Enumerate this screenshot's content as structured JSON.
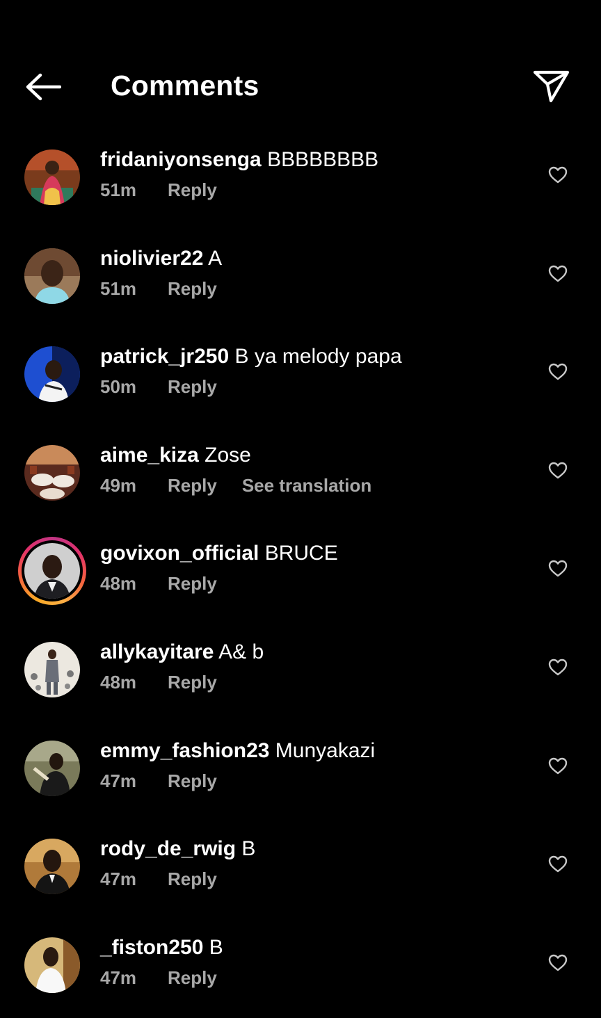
{
  "header": {
    "title": "Comments",
    "back_icon": "arrow-left-icon",
    "share_icon": "paper-plane-icon"
  },
  "colors": {
    "background": "#000000",
    "text_primary": "#ffffff",
    "text_secondary": "#a8a8a8"
  },
  "comments": [
    {
      "username": "fridaniyonsenga",
      "text": "BBBBBBBB",
      "time": "51m",
      "reply": "Reply",
      "has_story": false
    },
    {
      "username": "niolivier22",
      "text": "A",
      "time": "51m",
      "reply": "Reply",
      "has_story": false
    },
    {
      "username": "patrick_jr250",
      "text": "B ya melody papa",
      "time": "50m",
      "reply": "Reply",
      "has_story": false
    },
    {
      "username": "aime_kiza",
      "text": "Zose",
      "time": "49m",
      "reply": "Reply",
      "translate": "See translation",
      "has_story": false
    },
    {
      "username": "govixon_official",
      "text": "BRUCE",
      "time": "48m",
      "reply": "Reply",
      "has_story": true
    },
    {
      "username": "allykayitare",
      "text": "A& b",
      "time": "48m",
      "reply": "Reply",
      "has_story": false
    },
    {
      "username": "emmy_fashion23",
      "text": "Munyakazi",
      "time": "47m",
      "reply": "Reply",
      "has_story": false
    },
    {
      "username": "rody_de_rwig",
      "text": "B",
      "time": "47m",
      "reply": "Reply",
      "has_story": false
    },
    {
      "username": "_fiston250",
      "text": "B",
      "time": "47m",
      "reply": "Reply",
      "has_story": false
    }
  ]
}
